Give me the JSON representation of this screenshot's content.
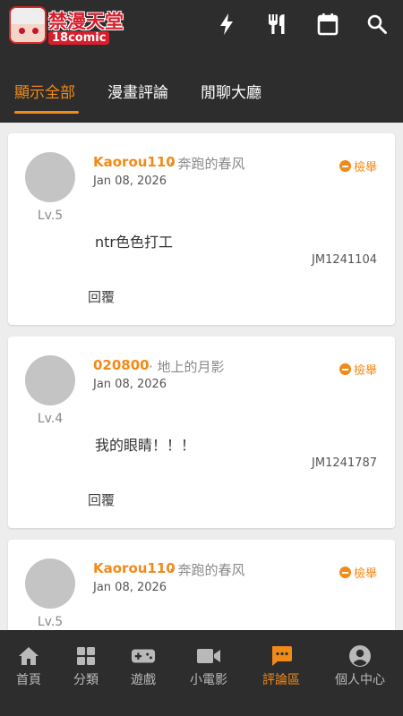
{
  "header": {
    "logo_title": "禁漫天堂",
    "logo_sub": "18comic",
    "icons": [
      "flash-icon",
      "restaurant-icon",
      "calendar-icon",
      "search-icon"
    ]
  },
  "tabs": [
    {
      "label": "顯示全部",
      "active": true
    },
    {
      "label": "漫畫評論",
      "active": false
    },
    {
      "label": "閒聊大廳",
      "active": false
    }
  ],
  "comments": [
    {
      "username": "Kaorou110",
      "separator": "· 奔跑的春风",
      "date": "Jan 08, 2026",
      "level": "Lv.5",
      "report": "檢舉",
      "content": "ntr色色打工",
      "jm_id": "JM1241104",
      "reply": "回覆"
    },
    {
      "username": "020800",
      "separator": "· 地上的月影",
      "date": "Jan 08, 2026",
      "level": "Lv.4",
      "report": "檢舉",
      "content": "我的眼睛！！！",
      "jm_id": "JM1241787",
      "reply": "回覆"
    },
    {
      "username": "Kaorou110",
      "separator": "· 奔跑的春风",
      "date": "Jan 08, 2026",
      "level": "Lv.5",
      "report": "檢舉"
    }
  ],
  "bottom_nav": [
    {
      "label": "首頁",
      "icon": "home-icon",
      "active": false
    },
    {
      "label": "分類",
      "icon": "grid-icon",
      "active": false
    },
    {
      "label": "遊戲",
      "icon": "gamepad-icon",
      "active": false
    },
    {
      "label": "小電影",
      "icon": "video-icon",
      "active": false
    },
    {
      "label": "評論區",
      "icon": "comment-icon",
      "active": true
    },
    {
      "label": "個人中心",
      "icon": "profile-icon",
      "active": false
    }
  ],
  "colors": {
    "accent": "#f28a17",
    "bar_background": "#2d2d2d",
    "page_background": "#ededed",
    "avatar_placeholder": "#c4c4c4"
  }
}
